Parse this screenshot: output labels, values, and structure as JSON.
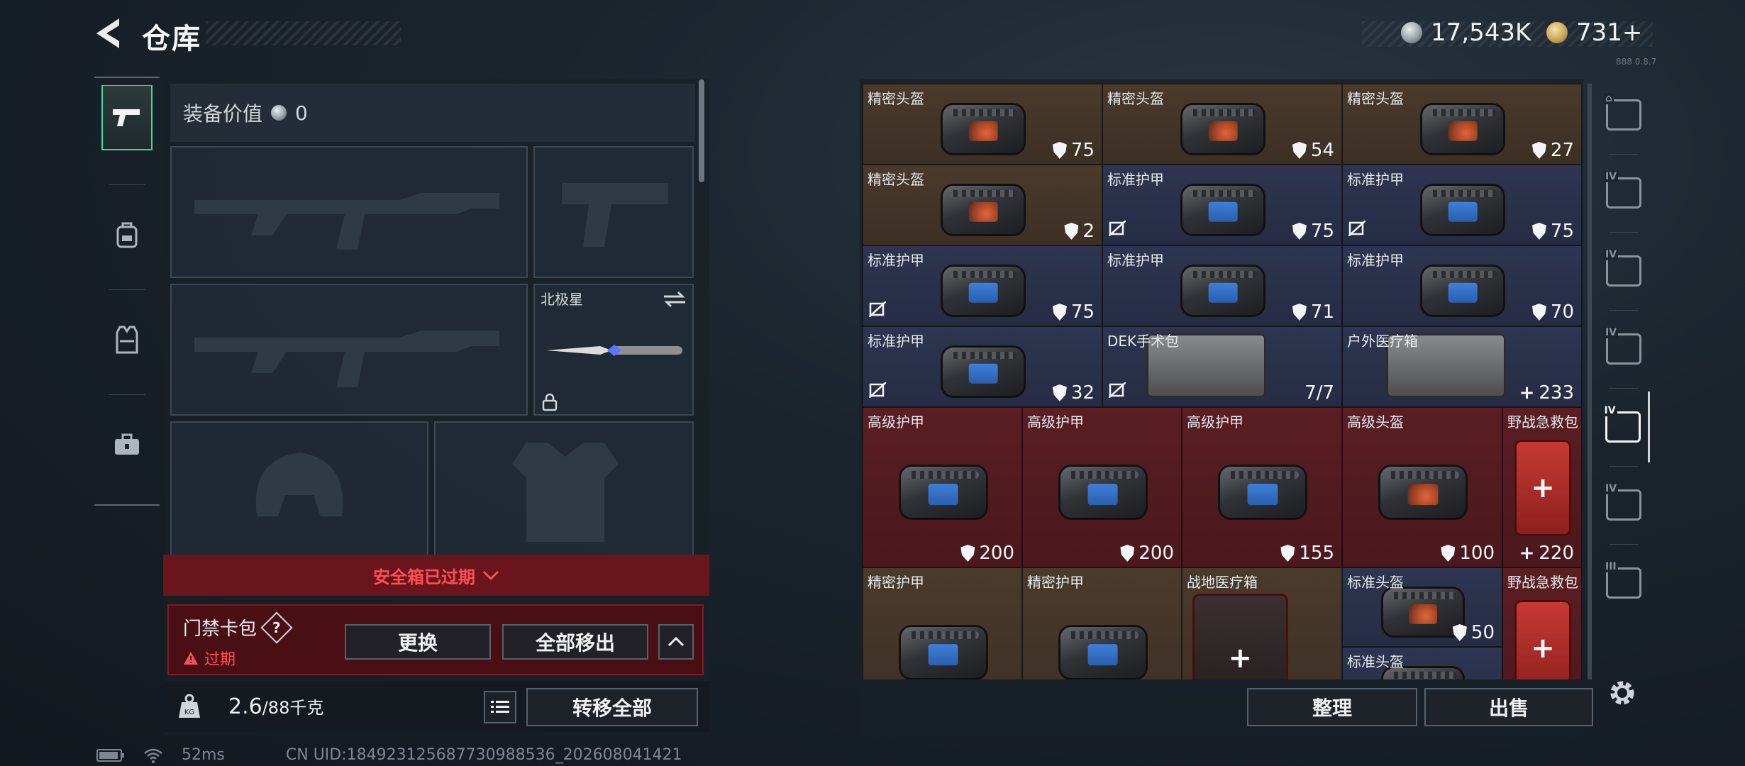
{
  "header": {
    "title": "仓库",
    "currency_silver": "17,543K",
    "currency_gold": "731+",
    "version_code": "888 0.8.7"
  },
  "left_nav": {
    "items": [
      "pistol-icon",
      "backpack-icon",
      "vest-icon",
      "toolbox-icon"
    ],
    "active_index": 0
  },
  "loadout": {
    "value_label": "装备价值",
    "value": "0",
    "melee_name": "北极星",
    "safe_box_status": "安全箱已过期",
    "keycard_title": "门禁卡包",
    "keycard_help": "?",
    "keycard_status": "过期",
    "replace_label": "更换",
    "move_all_label": "全部移出",
    "weight_current": "2.6",
    "weight_max": "/88千克",
    "transfer_all_label": "转移全部"
  },
  "inventory": {
    "cells": [
      {
        "name": "精密头盔",
        "value": "75",
        "color": "brown",
        "kind": "helmet",
        "icon": "shield"
      },
      {
        "name": "精密头盔",
        "value": "54",
        "color": "brown",
        "kind": "helmet",
        "icon": "shield"
      },
      {
        "name": "精密头盔",
        "value": "27",
        "color": "brown",
        "kind": "helmet",
        "icon": "shield"
      },
      {
        "name": "精密头盔",
        "value": "2",
        "color": "brown",
        "kind": "helmet",
        "icon": "shield"
      },
      {
        "name": "标准护甲",
        "value": "75",
        "color": "blue",
        "kind": "armor",
        "icon": "shield",
        "no_repair": true
      },
      {
        "name": "标准护甲",
        "value": "75",
        "color": "blue",
        "kind": "armor",
        "icon": "shield",
        "no_repair": true
      },
      {
        "name": "标准护甲",
        "value": "75",
        "color": "blue",
        "kind": "armor",
        "icon": "shield",
        "no_repair": true
      },
      {
        "name": "标准护甲",
        "value": "71",
        "color": "blue",
        "kind": "armor",
        "icon": "shield"
      },
      {
        "name": "标准护甲",
        "value": "70",
        "color": "blue",
        "kind": "armor",
        "icon": "shield"
      },
      {
        "name": "标准护甲",
        "value": "32",
        "color": "blue",
        "kind": "armor",
        "icon": "shield",
        "no_repair": true
      },
      {
        "name": "DEK手术包",
        "value": "7/7",
        "color": "blue",
        "kind": "surgery",
        "icon": "none",
        "no_repair": true
      },
      {
        "name": "户外医疗箱",
        "value": "233",
        "color": "blue",
        "kind": "medcase",
        "icon": "plus"
      },
      {
        "name": "高级护甲",
        "value": "200",
        "color": "red",
        "kind": "armor",
        "icon": "shield"
      },
      {
        "name": "高级护甲",
        "value": "200",
        "color": "red",
        "kind": "armor",
        "icon": "shield"
      },
      {
        "name": "高级护甲",
        "value": "155",
        "color": "red",
        "kind": "armor",
        "icon": "shield"
      },
      {
        "name": "高级头盔",
        "value": "100",
        "color": "red",
        "kind": "helmet",
        "icon": "shield"
      },
      {
        "name": "野战急救包",
        "value": "220",
        "color": "red",
        "kind": "medkit",
        "icon": "plus"
      },
      {
        "name": "精密护甲",
        "value": "",
        "color": "brown",
        "kind": "armor",
        "icon": "none"
      },
      {
        "name": "精密护甲",
        "value": "",
        "color": "brown",
        "kind": "armor",
        "icon": "none"
      },
      {
        "name": "战地医疗箱",
        "value": "",
        "color": "brown",
        "kind": "fieldbox",
        "icon": "none"
      },
      {
        "name": "标准头盔",
        "value": "50",
        "color": "blue",
        "kind": "helmet",
        "icon": "shield"
      },
      {
        "name": "野战急救包",
        "value": "",
        "color": "red",
        "kind": "medkit",
        "icon": "none"
      },
      {
        "name": "标准头盔",
        "value": "",
        "color": "blue",
        "kind": "helmet",
        "icon": "none"
      }
    ],
    "sort_label": "整理",
    "sell_label": "出售"
  },
  "right_nav": {
    "items": [
      "helmet-icon",
      "folder-iv-icon",
      "case-iv-icon",
      "wrench-iv-icon",
      "medkit-iv-icon",
      "case-iv-icon-2",
      "case-iii-icon"
    ],
    "active_index": 4
  },
  "status": {
    "ping": "52ms",
    "uid": "CN UID:184923125687730988536_202608041421"
  }
}
